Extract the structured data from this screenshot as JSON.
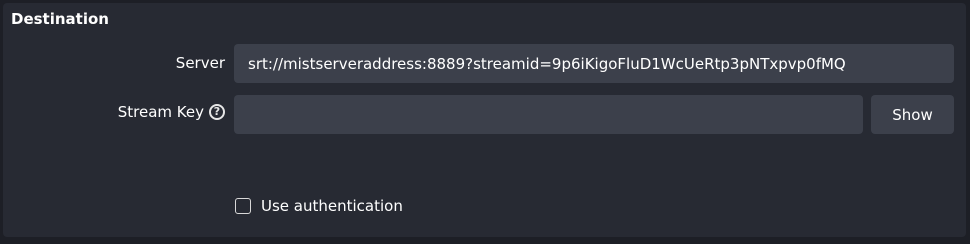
{
  "section": {
    "title": "Destination"
  },
  "server": {
    "label": "Server",
    "value": "srt://mistserveraddress:8889?streamid=9p6iKigoFluD1WcUeRtp3pNTxpvp0fMQ"
  },
  "stream_key": {
    "label": "Stream Key",
    "help_icon": "?",
    "value": "",
    "show_label": "Show"
  },
  "authentication": {
    "label": "Use authentication",
    "checked": false
  }
}
